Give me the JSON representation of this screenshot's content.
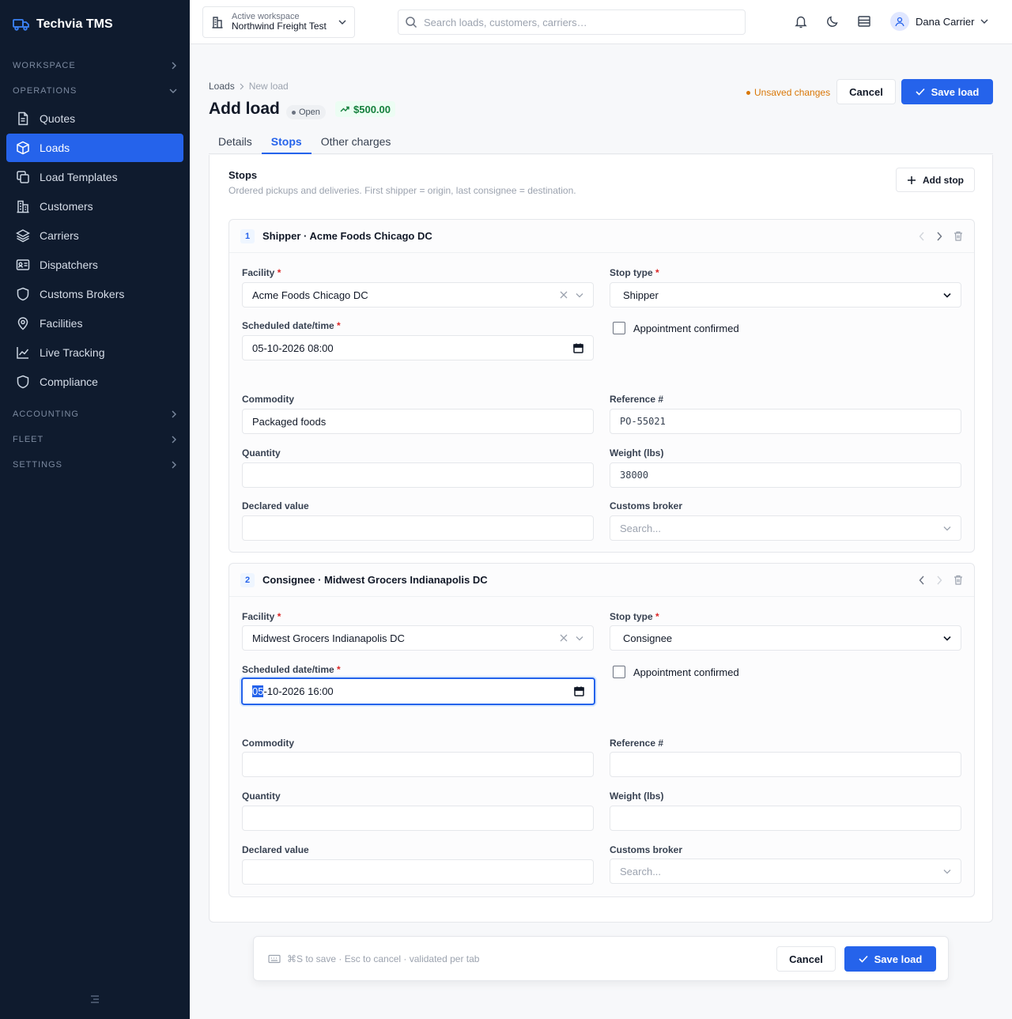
{
  "brand": {
    "name": "Techvia TMS",
    "icon": "truck-icon",
    "accent": "#2563eb"
  },
  "sidebar": {
    "sections": {
      "workspace": "WORKSPACE",
      "operations": "OPERATIONS",
      "accounting": "ACCOUNTING",
      "fleet": "FLEET",
      "settings": "SETTINGS"
    },
    "items": [
      {
        "label": "Quotes",
        "icon": "file-icon"
      },
      {
        "label": "Loads",
        "icon": "box-icon",
        "active": true
      },
      {
        "label": "Load Templates",
        "icon": "copy-icon"
      },
      {
        "label": "Customers",
        "icon": "building-icon"
      },
      {
        "label": "Carriers",
        "icon": "layers-icon"
      },
      {
        "label": "Dispatchers",
        "icon": "id-card-icon"
      },
      {
        "label": "Customs Brokers",
        "icon": "shield-icon"
      },
      {
        "label": "Facilities",
        "icon": "map-pin-icon"
      },
      {
        "label": "Live Tracking",
        "icon": "chart-line-icon"
      },
      {
        "label": "Compliance",
        "icon": "shield-icon"
      }
    ]
  },
  "topbar": {
    "workspace_label": "Active workspace",
    "workspace_name": "Northwind Freight Test",
    "search_placeholder": "Search loads, customers, carriers…",
    "user_name": "Dana Carrier"
  },
  "page": {
    "breadcrumb": [
      "Loads",
      "New load"
    ],
    "title": "Add load",
    "status": "Open",
    "amount": "$500.00",
    "unsaved": "Unsaved changes",
    "cancel": "Cancel",
    "save": "Save load",
    "tabs": [
      "Details",
      "Stops",
      "Other charges"
    ],
    "active_tab": "Stops"
  },
  "stops_section": {
    "title": "Stops",
    "subtitle": "Ordered pickups and deliveries. First shipper = origin, last consignee = destination.",
    "add_stop": "Add stop"
  },
  "labels": {
    "facility": "Facility",
    "stop_type": "Stop type",
    "scheduled": "Scheduled date/time",
    "appointment": "Appointment confirmed",
    "commodity": "Commodity",
    "reference": "Reference #",
    "quantity": "Quantity",
    "weight": "Weight (lbs)",
    "declared": "Declared value",
    "broker": "Customs broker",
    "required": "*"
  },
  "stops": [
    {
      "num": "1",
      "title": "Shipper · Acme Foods Chicago DC",
      "facility": "Acme Foods Chicago DC",
      "stop_type": "Shipper",
      "datetime": "05-10-2026 08:00",
      "appointment_confirmed": false,
      "commodity": "Packaged foods",
      "reference": "PO-55021",
      "quantity": "",
      "weight": "38000",
      "declared": "",
      "broker_placeholder": "Search..."
    },
    {
      "num": "2",
      "title": "Consignee · Midwest Grocers Indianapolis DC",
      "facility": "Midwest Grocers Indianapolis DC",
      "stop_type": "Consignee",
      "datetime_selected": "05",
      "datetime_rest": "-10-2026 16:00",
      "appointment_confirmed": false,
      "commodity": "",
      "reference": "",
      "quantity": "",
      "weight": "",
      "declared": "",
      "broker_placeholder": "Search..."
    }
  ],
  "footer": {
    "hint": "⌘S to save · Esc to cancel · validated per tab",
    "cancel": "Cancel",
    "save": "Save load"
  }
}
